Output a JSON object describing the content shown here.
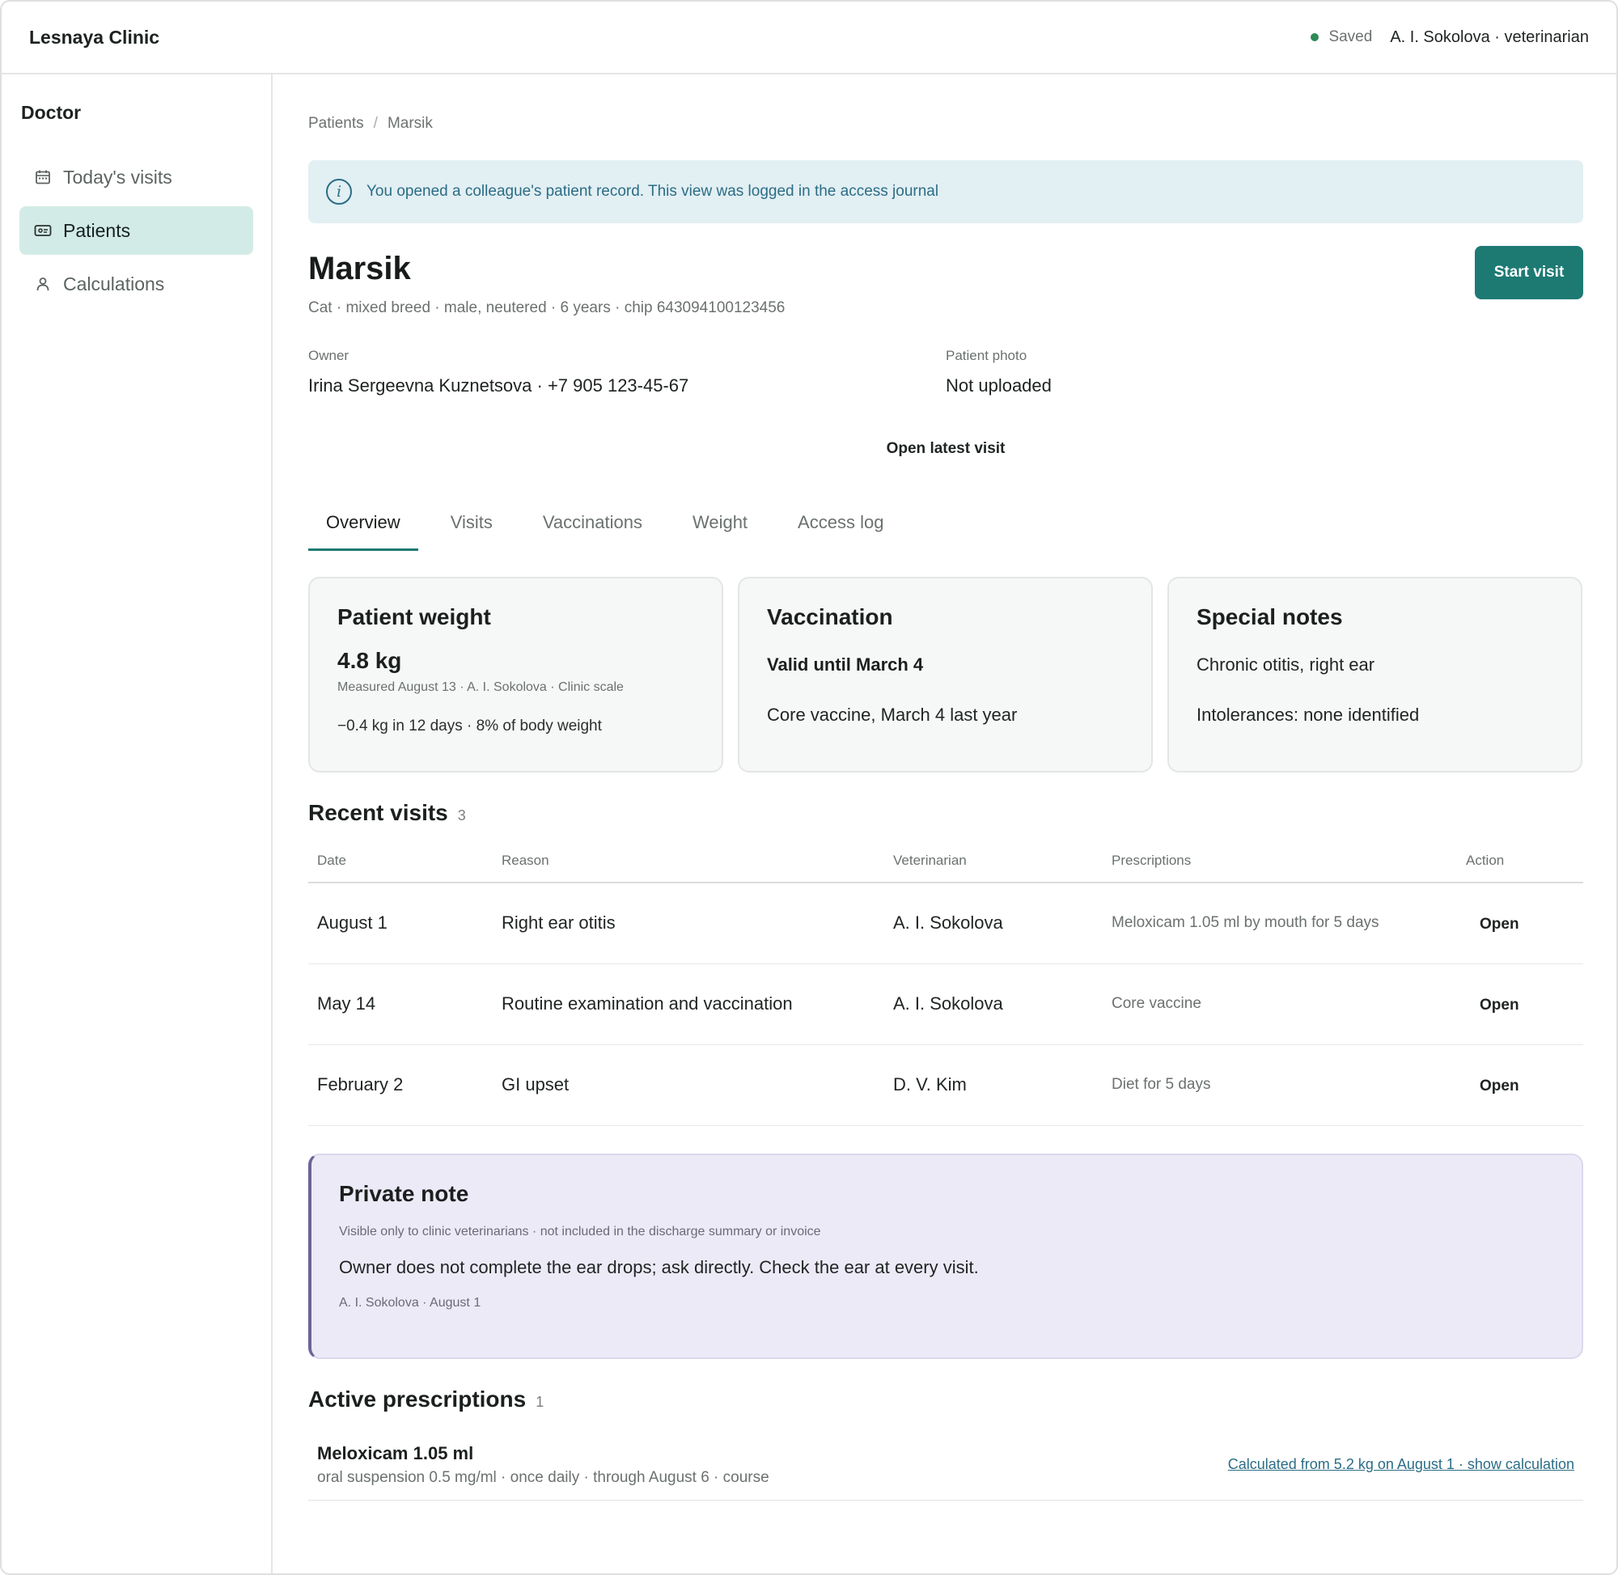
{
  "header": {
    "brand": "Lesnaya Clinic",
    "status": "Saved",
    "status_color": "#2e8a57",
    "user": "A. I. Sokolova · veterinarian"
  },
  "sidebar": {
    "title": "Doctor",
    "items": [
      {
        "label": "Today's visits",
        "icon": "calendar-icon",
        "active": false
      },
      {
        "label": "Patients",
        "icon": "id-card-icon",
        "active": true
      },
      {
        "label": "Calculations",
        "icon": "person-icon",
        "active": false
      }
    ]
  },
  "breadcrumb": {
    "root": "Patients",
    "sep": "/",
    "current": "Marsik"
  },
  "banner": {
    "icon": "info-icon",
    "text": "You opened a colleague's patient record. This view was logged in the access journal"
  },
  "patient": {
    "name": "Marsik",
    "summary": "Cat · mixed breed · male, neutered · 6 years · chip 643094100123456",
    "start_visit": "Start visit",
    "owner_label": "Owner",
    "owner_value": "Irina Sergeevna Kuznetsova · +7 905 123-45-67",
    "photo_label": "Patient photo",
    "photo_value": "Not uploaded",
    "open_latest": "Open latest visit"
  },
  "tabs": [
    {
      "label": "Overview",
      "active": true
    },
    {
      "label": "Visits",
      "active": false
    },
    {
      "label": "Vaccinations",
      "active": false
    },
    {
      "label": "Weight",
      "active": false
    },
    {
      "label": "Access log",
      "active": false
    }
  ],
  "cards": {
    "weight": {
      "title": "Patient weight",
      "value": "4.8 kg",
      "meta": "Measured August 13 · A. I. Sokolova · Clinic scale",
      "change": "−0.4 kg in 12 days · 8% of body weight"
    },
    "vaccination": {
      "title": "Vaccination",
      "valid": "Valid until March 4",
      "detail": "Core vaccine, March 4 last year"
    },
    "notes": {
      "title": "Special notes",
      "line1": "Chronic otitis, right ear",
      "line2": "Intolerances: none identified"
    }
  },
  "recent_visits": {
    "title": "Recent visits",
    "count": "3",
    "columns": [
      "Date",
      "Reason",
      "Veterinarian",
      "Prescriptions",
      "Action"
    ],
    "rows": [
      {
        "date": "August 1",
        "reason": "Right ear otitis",
        "vet": "A. I. Sokolova",
        "presc": "Meloxicam 1.05 ml by mouth for 5 days",
        "action": "Open"
      },
      {
        "date": "May 14",
        "reason": "Routine examination and vaccination",
        "vet": "A. I. Sokolova",
        "presc": "Core vaccine",
        "action": "Open"
      },
      {
        "date": "February 2",
        "reason": "GI upset",
        "vet": "D. V. Kim",
        "presc": "Diet for 5 days",
        "action": "Open"
      }
    ]
  },
  "private_note": {
    "title": "Private note",
    "sub": "Visible only to clinic veterinarians · not included in the discharge summary or invoice",
    "body": "Owner does not complete the ear drops; ask directly. Check the ear at every visit.",
    "by": "A. I. Sokolova · August 1"
  },
  "prescriptions": {
    "title": "Active prescriptions",
    "count": "1",
    "items": [
      {
        "name": "Meloxicam 1.05 ml",
        "detail": "oral suspension 0.5 mg/ml · once daily · through August 6 · course",
        "link": "Calculated from 5.2 kg on August 1 · show calculation"
      }
    ]
  },
  "colors": {
    "accent": "#1d7a73",
    "info": "#2b6d86",
    "private_bg": "#edeaf7"
  }
}
